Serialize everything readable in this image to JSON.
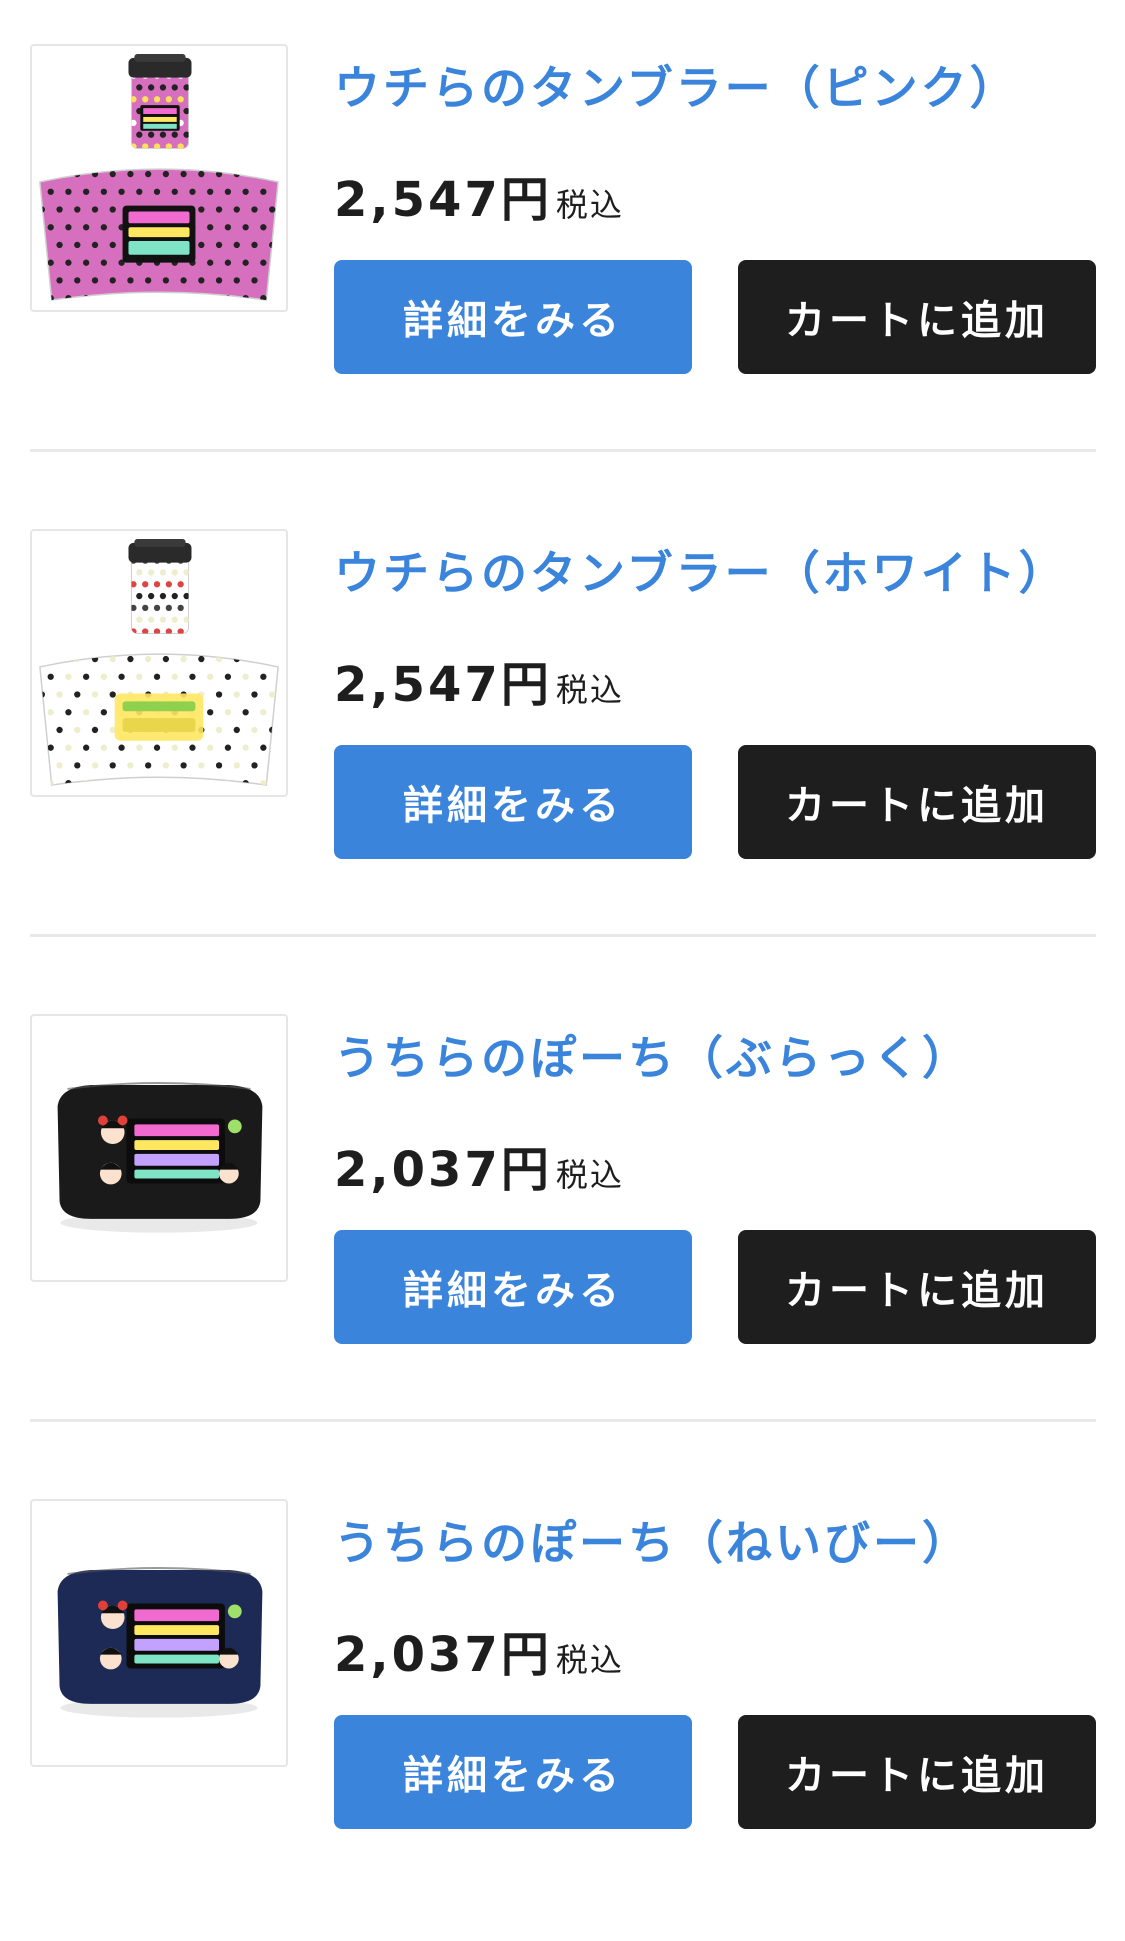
{
  "products": [
    {
      "name": "ウチらのタンブラー（ピンク）",
      "price": "2,547円",
      "tax_label": "税込",
      "detail_label": "詳細をみる",
      "cart_label": "カートに追加",
      "image_kind": "tumbler",
      "image_color": "#d66fbe"
    },
    {
      "name": "ウチらのタンブラー（ホワイト）",
      "price": "2,547円",
      "tax_label": "税込",
      "detail_label": "詳細をみる",
      "cart_label": "カートに追加",
      "image_kind": "tumbler",
      "image_color": "#ffffff"
    },
    {
      "name": "うちらのぽーち（ぶらっく）",
      "price": "2,037円",
      "tax_label": "税込",
      "detail_label": "詳細をみる",
      "cart_label": "カートに追加",
      "image_kind": "pouch",
      "image_color": "#1a1a1a"
    },
    {
      "name": "うちらのぽーち（ねいびー）",
      "price": "2,037円",
      "tax_label": "税込",
      "detail_label": "詳細をみる",
      "cart_label": "カートに追加",
      "image_kind": "pouch",
      "image_color": "#1c2a55"
    }
  ],
  "colors": {
    "accent": "#3a84dc",
    "dark_button": "#1e1e1e",
    "divider": "#e9e9e9"
  }
}
